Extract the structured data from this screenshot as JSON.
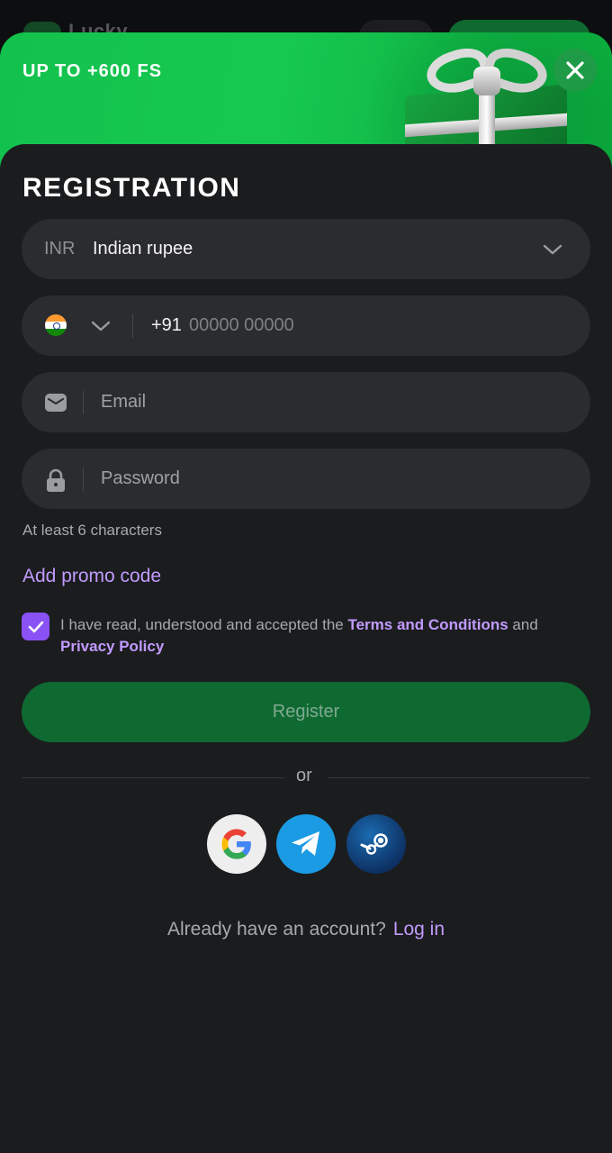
{
  "site": {
    "brand": "Lucky"
  },
  "banner": {
    "title": "UP TO +600 FS",
    "close_icon": "close-icon"
  },
  "registration": {
    "title": "REGISTRATION",
    "currency": {
      "code": "INR",
      "name": "Indian rupee"
    },
    "phone": {
      "prefix": "+91",
      "placeholder": "00000 00000",
      "country_flag": "india-flag-icon"
    },
    "email": {
      "placeholder": "Email"
    },
    "password": {
      "placeholder": "Password",
      "hint": "At least 6 characters"
    },
    "promo_link": "Add promo code",
    "terms": {
      "checked": true,
      "prefix": "I have read, understood and accepted the",
      "terms_link": "Terms and Conditions",
      "and": "and",
      "privacy_link": "Privacy Policy"
    },
    "register_button": "Register",
    "or_text": "or",
    "social": [
      "google",
      "telegram",
      "steam"
    ],
    "account_question": "Already have an account?",
    "login_link": "Log in"
  },
  "colors": {
    "accent_purple": "#c19bff",
    "checkbox": "#8a52f5",
    "register_bg": "#0f6a32",
    "banner_green": "#16c850",
    "field_bg": "#2b2c2f",
    "sheet_bg": "#1b1c1e"
  }
}
